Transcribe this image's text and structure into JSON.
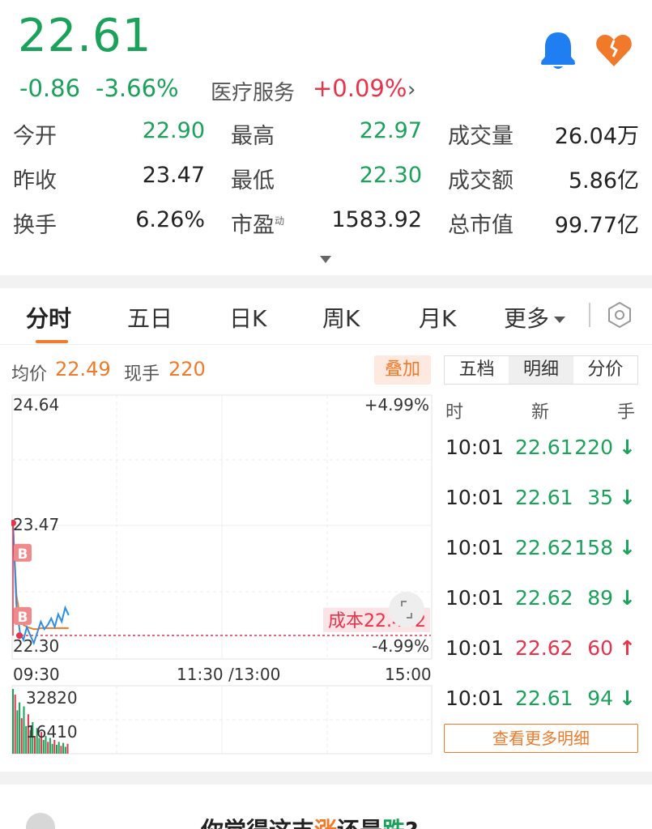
{
  "quote": {
    "price": "22.61",
    "change": "-0.86",
    "change_pct": "-3.66%",
    "sector_name": "医疗服务",
    "sector_pct": "+0.09%"
  },
  "stats": [
    [
      {
        "label": "今开",
        "value": "22.90",
        "color": "green"
      },
      {
        "label": "最高",
        "value": "22.97",
        "color": "green"
      },
      {
        "label": "成交量",
        "value": "26.04万",
        "color": "plain"
      }
    ],
    [
      {
        "label": "昨收",
        "value": "23.47",
        "color": "plain"
      },
      {
        "label": "最低",
        "value": "22.30",
        "color": "green"
      },
      {
        "label": "成交额",
        "value": "5.86亿",
        "color": "plain"
      }
    ],
    [
      {
        "label": "换手",
        "value": "6.26%",
        "color": "plain"
      },
      {
        "label": "市盈",
        "sup": "动",
        "value": "1583.92",
        "color": "plain"
      },
      {
        "label": "总市值",
        "value": "99.77亿",
        "color": "plain"
      }
    ]
  ],
  "tabs": [
    "分时",
    "五日",
    "日K",
    "周K",
    "月K",
    "更多"
  ],
  "info": {
    "avg_label": "均价",
    "avg_value": "22.49",
    "hand_label": "现手",
    "hand_value": "220",
    "overlay_label": "叠加"
  },
  "chart_data": {
    "type": "line",
    "y_labels": [
      "24.64",
      "23.47",
      "22.30"
    ],
    "pct_labels": [
      "+4.99%",
      "-4.99%"
    ],
    "x_labels": [
      "09:30",
      "11:30 /13:00",
      "15:00"
    ],
    "ylim": [
      22.3,
      24.64
    ],
    "cost_label": "成本22.422",
    "cost_value": 22.422,
    "trade_marker": "B",
    "volume_labels": [
      "32820",
      "16410"
    ],
    "volume_max": 32820,
    "price_series": [
      23.47,
      22.7,
      22.45,
      22.38,
      22.5,
      22.42,
      22.35,
      22.45,
      22.55,
      22.48,
      22.52,
      22.58,
      22.5,
      22.62,
      22.55,
      22.68,
      22.61
    ],
    "avg_series": [
      23.47,
      22.8,
      22.6,
      22.52,
      22.5,
      22.49,
      22.48,
      22.48,
      22.49,
      22.49,
      22.49,
      22.49,
      22.49,
      22.49,
      22.49,
      22.49,
      22.49
    ],
    "volume_series": [
      32820,
      30000,
      22000,
      26000,
      18000,
      24000,
      14000,
      20000,
      12000,
      16000,
      9000,
      13000,
      8000,
      11000,
      7000,
      9000,
      6000,
      8000,
      5000,
      7000,
      4500,
      6000,
      4000,
      5500,
      3500,
      5000
    ]
  },
  "detail": {
    "segments": [
      "五档",
      "明细",
      "分价"
    ],
    "headers": [
      "时",
      "新",
      "手"
    ],
    "rows": [
      {
        "time": "10:01",
        "price": "22.61",
        "vol": "220",
        "dir": "↓"
      },
      {
        "time": "10:01",
        "price": "22.61",
        "vol": "35",
        "dir": "↓"
      },
      {
        "time": "10:01",
        "price": "22.62",
        "vol": "158",
        "dir": "↓"
      },
      {
        "time": "10:01",
        "price": "22.62",
        "vol": "89",
        "dir": "↓"
      },
      {
        "time": "10:01",
        "price": "22.62",
        "vol": "60",
        "dir": "↑"
      },
      {
        "time": "10:01",
        "price": "22.61",
        "vol": "94",
        "dir": "↓"
      }
    ],
    "more_label": "查看更多明细"
  },
  "poll": {
    "question_pre": "你觉得这支",
    "up": "涨",
    "question_mid": "还是",
    "down": "跌",
    "question_end": "?"
  },
  "colors": {
    "up": "#e8334a",
    "down": "#1aa15a",
    "accent": "#f07a2a",
    "bell": "#1f7ef2"
  }
}
